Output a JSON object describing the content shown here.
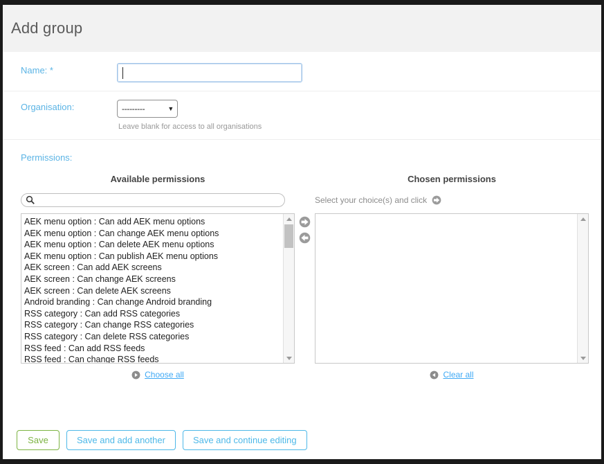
{
  "header": {
    "title": "Add group"
  },
  "form": {
    "name": {
      "label": "Name: *",
      "value": "",
      "placeholder": ""
    },
    "organisation": {
      "label": "Organisation:",
      "selected": "---------",
      "options": [
        "---------"
      ],
      "help": "Leave blank for access to all organisations"
    },
    "permissions": {
      "label": "Permissions:"
    }
  },
  "available": {
    "heading": "Available permissions",
    "search_placeholder": "",
    "search_value": "",
    "search_icon": "search-icon",
    "items": [
      "AEK menu option : Can add AEK menu options",
      "AEK menu option : Can change AEK menu options",
      "AEK menu option : Can delete AEK menu options",
      "AEK menu option : Can publish AEK menu options",
      "AEK screen : Can add AEK screens",
      "AEK screen : Can change AEK screens",
      "AEK screen : Can delete AEK screens",
      "Android branding : Can change Android branding",
      "RSS category : Can add RSS categories",
      "RSS category : Can change RSS categories",
      "RSS category : Can delete RSS categories",
      "RSS feed : Can add RSS feeds",
      "RSS feed : Can change RSS feeds"
    ],
    "choose_all_label": "Choose all",
    "choose_all_icon": "arrow-right-circle-icon"
  },
  "chosen": {
    "heading": "Chosen permissions",
    "helper_text": "Select your choice(s) and click",
    "helper_icon": "arrow-right-circle-icon",
    "items": [],
    "clear_all_label": "Clear all",
    "clear_all_icon": "arrow-left-circle-icon"
  },
  "transfer": {
    "add_icon": "arrow-right-circle-icon",
    "remove_icon": "arrow-left-circle-icon"
  },
  "footer": {
    "save_label": "Save",
    "save_and_add_label": "Save and add another",
    "save_and_continue_label": "Save and continue editing"
  },
  "colors": {
    "accent_blue": "#5bb4e5",
    "link_blue": "#3fa9f5",
    "save_green": "#7cb342",
    "header_bg": "#f2f2f2",
    "frame_black": "#1a1a1a"
  }
}
